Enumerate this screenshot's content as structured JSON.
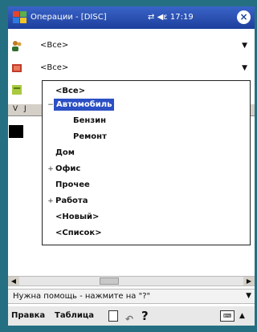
{
  "titlebar": {
    "title": "Операции - [DISC]",
    "time": "17:19",
    "close": "×"
  },
  "filters": [
    {
      "value": "<Все>",
      "icon": "people-icon"
    },
    {
      "value": "<Все>",
      "icon": "folder-icon"
    }
  ],
  "grid": {
    "header_cells": [
      "V",
      "J"
    ]
  },
  "dropdown": {
    "items": [
      {
        "label": "<Все>",
        "level": 0,
        "expander": ""
      },
      {
        "label": "Автомобиль",
        "level": 0,
        "expander": "−",
        "selected": true
      },
      {
        "label": "Бензин",
        "level": 1,
        "expander": ""
      },
      {
        "label": "Ремонт",
        "level": 1,
        "expander": ""
      },
      {
        "label": "Дом",
        "level": 0,
        "expander": ""
      },
      {
        "label": "Офис",
        "level": 0,
        "expander": "+"
      },
      {
        "label": "Прочее",
        "level": 0,
        "expander": ""
      },
      {
        "label": "Работа",
        "level": 0,
        "expander": "+"
      },
      {
        "label": "<Новый>",
        "level": 0,
        "expander": ""
      },
      {
        "label": "<Список>",
        "level": 0,
        "expander": ""
      }
    ]
  },
  "status": {
    "text": "Нужна помощь - нажмите на \"?\""
  },
  "menubar": {
    "edit": "Правка",
    "table": "Таблица",
    "help": "?"
  },
  "colors": {
    "titlebar": "#1d3f9c",
    "selection": "#2b4fc4",
    "background_frame": "#256f82"
  }
}
